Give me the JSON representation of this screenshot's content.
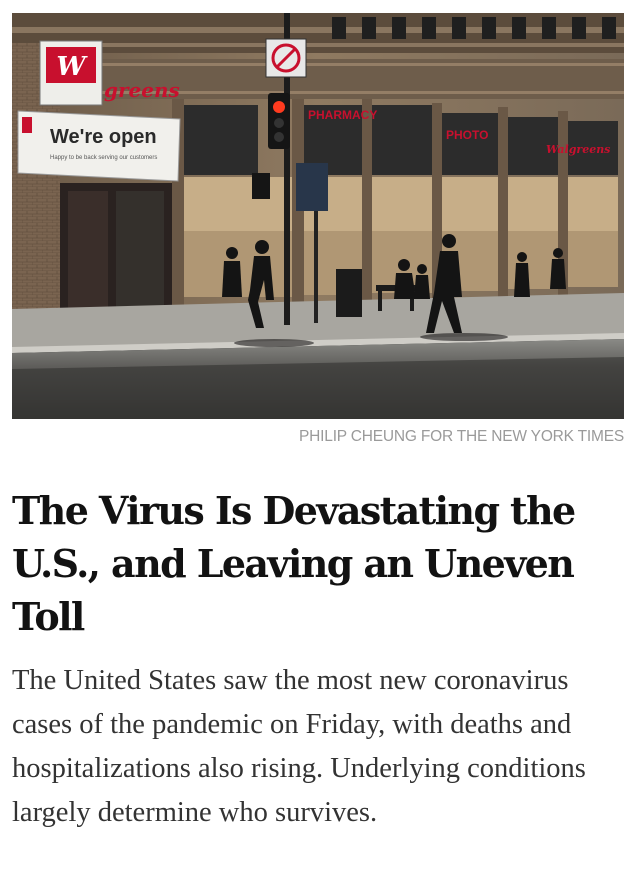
{
  "photo": {
    "signs": {
      "store_logo": "W",
      "store_name": "greens",
      "banner_main": "We're open",
      "banner_sub": "Happy to be back serving our customers",
      "pharmacy": "PHARMACY",
      "photo": "PHOTO",
      "walgreens_script": "Walgreens"
    },
    "colors": {
      "brand_red": "#c8102e",
      "traffic_light": "#ff3b1f"
    }
  },
  "credit": "PHILIP CHEUNG FOR THE NEW YORK TIMES",
  "headline": "The Virus Is Devastating the U.S., and Leaving an Uneven Toll",
  "summary": "The United States saw the most new coronavirus cases of the pandemic on Friday, with deaths and hospitalizations also rising. Underlying conditions largely determine who survives."
}
